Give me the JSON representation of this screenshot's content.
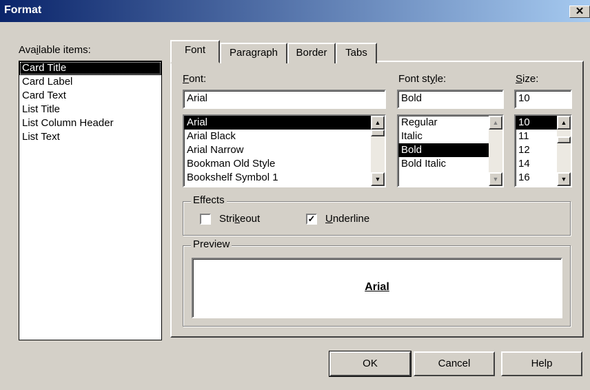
{
  "window": {
    "title": "Format",
    "close_glyph": "✕"
  },
  "available": {
    "label": "Available items:",
    "items": [
      "Card Title",
      "Card Label",
      "Card Text",
      "List Title",
      "List Column Header",
      "List Text"
    ],
    "selected": "Card Title"
  },
  "tabs": [
    {
      "label": "Font",
      "active": true
    },
    {
      "label": "Paragraph",
      "active": false
    },
    {
      "label": "Border",
      "active": false
    },
    {
      "label": "Tabs",
      "active": false
    }
  ],
  "font": {
    "label": "Font:",
    "value": "Arial",
    "list": [
      "Arial",
      "Arial Black",
      "Arial Narrow",
      "Bookman Old Style",
      "Bookshelf Symbol 1"
    ],
    "selected": "Arial"
  },
  "style": {
    "label": "Font style:",
    "value": "Bold",
    "list": [
      "Regular",
      "Italic",
      "Bold",
      "Bold Italic"
    ],
    "selected": "Bold"
  },
  "size": {
    "label": "Size:",
    "value": "10",
    "list": [
      "10",
      "11",
      "12",
      "14",
      "16"
    ],
    "selected": "10"
  },
  "effects": {
    "label": "Effects",
    "strikeout": {
      "label": "Strikeout",
      "checked": false
    },
    "underline": {
      "label": "Underline",
      "checked": true
    }
  },
  "preview": {
    "label": "Preview",
    "sample": "Arial"
  },
  "buttons": {
    "ok": "OK",
    "cancel": "Cancel",
    "help": "Help"
  },
  "icons": {
    "scroll_up": "up-arrow-icon",
    "scroll_down": "down-arrow-icon",
    "close": "close-icon",
    "check": "checkmark-icon"
  }
}
